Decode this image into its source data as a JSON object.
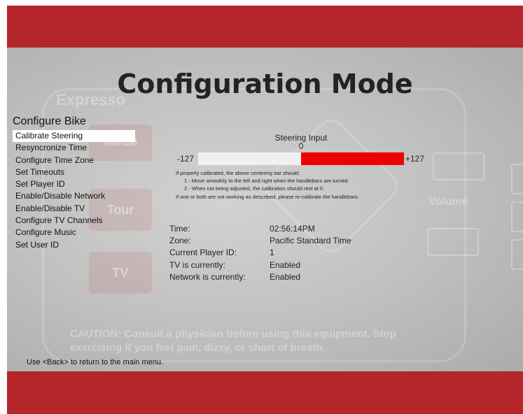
{
  "background": {
    "logo_text": "Expresso",
    "buttons": [
      "Manual",
      "Tour",
      "TV"
    ],
    "right_label": "Volume",
    "caution_text": "CAUTION: Consult a physician before using this equipment. Stop exercising if you feel pain, dizzy, or short of breath."
  },
  "header": {
    "title": "Configuration Mode"
  },
  "menu": {
    "title": "Configure Bike",
    "items": [
      {
        "label": "Calibrate Steering",
        "selected": true
      },
      {
        "label": "Resyncronize Time"
      },
      {
        "label": "Configure Time Zone"
      },
      {
        "label": "Set Timeouts"
      },
      {
        "label": "Set Player ID"
      },
      {
        "label": "Enable/Disable Network"
      },
      {
        "label": "Enable/Disable TV"
      },
      {
        "label": "Configure TV Channels"
      },
      {
        "label": "Configure Music"
      },
      {
        "label": "Set User ID"
      }
    ]
  },
  "steering": {
    "label": "Steering Input",
    "value": "0",
    "min_label": "-127",
    "max_label": "+127",
    "min": -127,
    "max": 127,
    "red_start_fraction": 0.5,
    "red_end_fraction": 1.0
  },
  "instructions": {
    "line1": "If properly calibrated, the above centering bar should:",
    "line2": "1 - Move smoothly to the left and right when the handlebars are turned.",
    "line3": "2 - When not being adjusted, the calibration should rest at 0.",
    "line4": "If one or both are not working as described, please re-calibrate the handlebars."
  },
  "status": [
    {
      "label": "Time:",
      "value": "02:56:14PM"
    },
    {
      "label": "Zone:",
      "value": "Pacific Standard Time"
    },
    {
      "label": "Current Player ID:",
      "value": "1"
    },
    {
      "label": "TV is currently:",
      "value": "Enabled"
    },
    {
      "label": "Network is currently:",
      "value": "Enabled"
    }
  ],
  "footer": {
    "hint": "Use <Back> to return to the main menu."
  },
  "colors": {
    "brand_red": "#b5262b",
    "bar_red": "#f00000",
    "selected_bg": "#ffffff"
  }
}
